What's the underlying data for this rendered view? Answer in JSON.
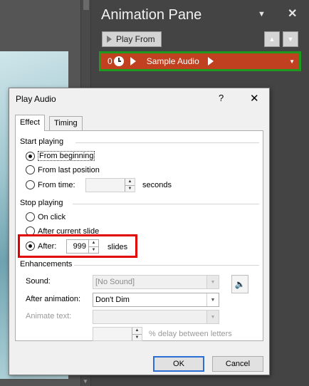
{
  "pane": {
    "title": "Animation Pane",
    "play_from_label": "Play From",
    "item": {
      "order": "0",
      "name": "Sample Audio"
    }
  },
  "dialog": {
    "title": "Play Audio",
    "help_glyph": "?",
    "close_glyph": "✕",
    "tabs": [
      "Effect",
      "Timing"
    ],
    "start_playing": {
      "heading": "Start playing",
      "from_beginning": "From beginning",
      "from_last_position": "From last position",
      "from_time": "From time:",
      "time_value": "",
      "seconds_label": "seconds",
      "selected": "from_beginning"
    },
    "stop_playing": {
      "heading": "Stop playing",
      "on_click": "On click",
      "after_current_slide": "After current slide",
      "after": "After:",
      "after_value": "999",
      "slides_label": "slides",
      "selected": "after"
    },
    "enhancements": {
      "heading": "Enhancements",
      "sound_label": "Sound:",
      "sound_value": "[No Sound]",
      "after_animation_label": "After animation:",
      "after_animation_value": "Don't Dim",
      "animate_text_label": "Animate text:",
      "animate_text_value": "",
      "delay_value": "",
      "delay_label": "% delay between letters"
    },
    "ok_label": "OK",
    "cancel_label": "Cancel"
  },
  "colors": {
    "pane_bg": "#444444",
    "item_bg": "#c0401f",
    "item_border": "#1e9a1e",
    "highlight": "#e00000",
    "ok_border": "#2b6fd6"
  }
}
